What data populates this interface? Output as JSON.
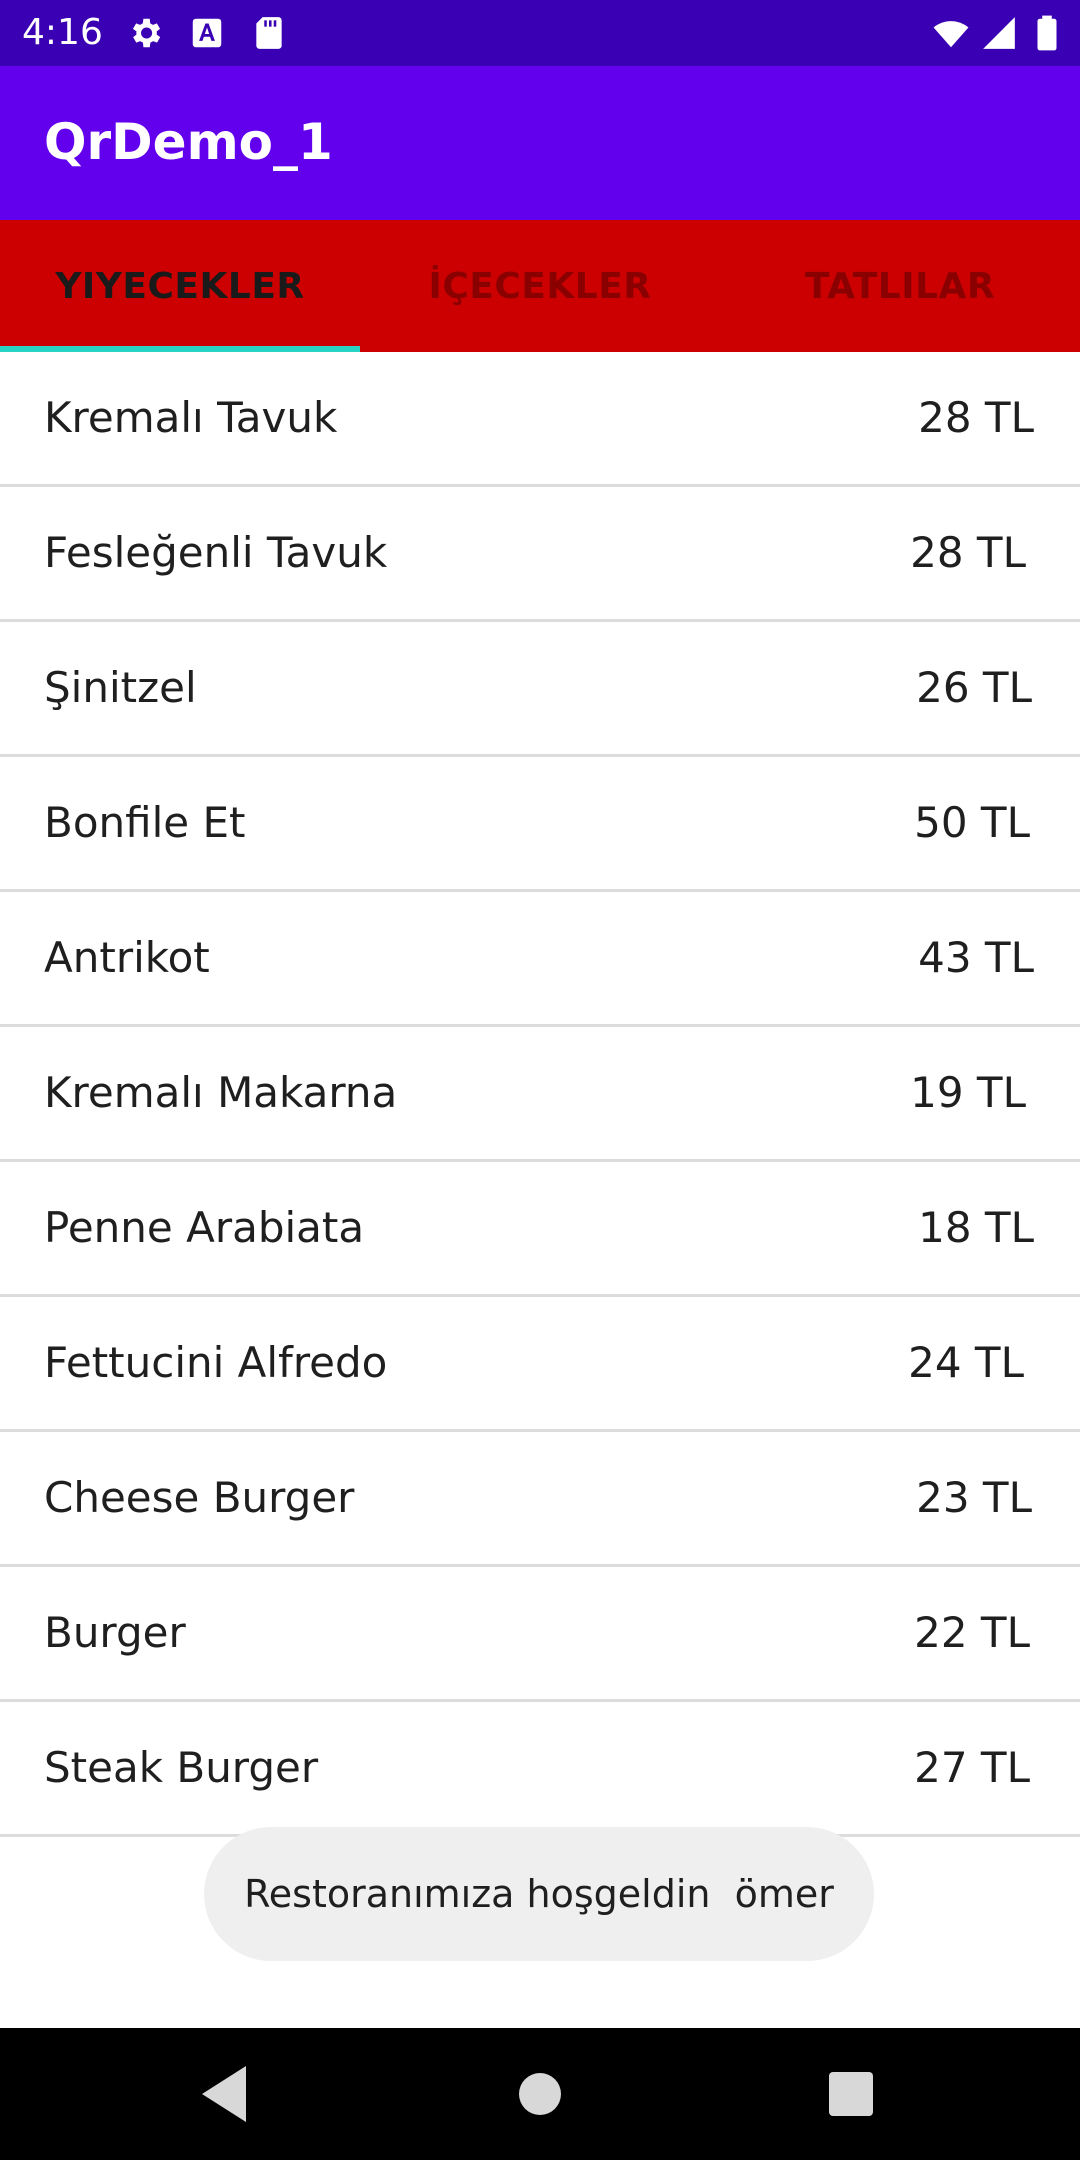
{
  "status_bar": {
    "time": "4:16",
    "left_icons": [
      "gear-icon",
      "font-a-icon",
      "sd-card-icon"
    ],
    "right_icons": [
      "wifi-icon",
      "cell-signal-icon",
      "battery-icon"
    ]
  },
  "app_bar": {
    "title": "QrDemo_1"
  },
  "tabs": [
    {
      "label": "YIYECEKLER",
      "selected": true
    },
    {
      "label": "İÇECEKLER",
      "selected": false
    },
    {
      "label": "TATLILAR",
      "selected": false
    }
  ],
  "menu_items": [
    {
      "name": "Kremalı Tavuk",
      "price": "28 TL"
    },
    {
      "name": "Fesleğenli Tavuk",
      "price": "28 TL"
    },
    {
      "name": "Şinitzel",
      "price": "26 TL"
    },
    {
      "name": "Bonfile Et",
      "price": "50 TL"
    },
    {
      "name": "Antrikot",
      "price": "43 TL"
    },
    {
      "name": "Kremalı Makarna",
      "price": "19 TL"
    },
    {
      "name": "Penne Arabiata",
      "price": "18 TL"
    },
    {
      "name": "Fettucini Alfredo",
      "price": "24 TL"
    },
    {
      "name": "Cheese Burger",
      "price": "23 TL"
    },
    {
      "name": "Burger",
      "price": "22 TL"
    },
    {
      "name": "Steak Burger",
      "price": "27 TL"
    }
  ],
  "toast": {
    "message": "Restoranımıza hoşgeldin  ömer"
  },
  "nav_bar": {
    "buttons": [
      "back-icon",
      "home-icon",
      "recents-icon"
    ]
  },
  "colors": {
    "status_bar": "#3a00b3",
    "app_bar": "#6200ee",
    "tab_bar": "#cc0000",
    "tab_indicator": "#29d3c4",
    "nav_bar": "#000000"
  }
}
